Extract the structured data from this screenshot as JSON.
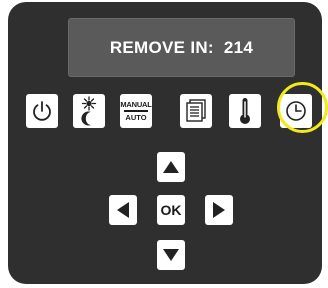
{
  "display": {
    "text": "REMOVE IN:  214"
  },
  "buttons": {
    "power_icon": "power-icon",
    "daynight_icon": "sun-moon-icon",
    "manual_auto": {
      "top_label": "MANUAL",
      "bottom_label": "AUTO"
    },
    "menu_icon": "menu-list-icon",
    "temperature_icon": "thermometer-icon",
    "clock_icon": "clock-icon"
  },
  "navigation": {
    "up_icon": "arrow-up-icon",
    "down_icon": "arrow-down-icon",
    "left_icon": "arrow-left-icon",
    "right_icon": "arrow-right-icon",
    "ok_label": "OK"
  },
  "colors": {
    "panel": "#2f2f2f",
    "lcd": "#5a5a5a",
    "button": "#ffffff",
    "highlight": "#f2ea1a"
  }
}
